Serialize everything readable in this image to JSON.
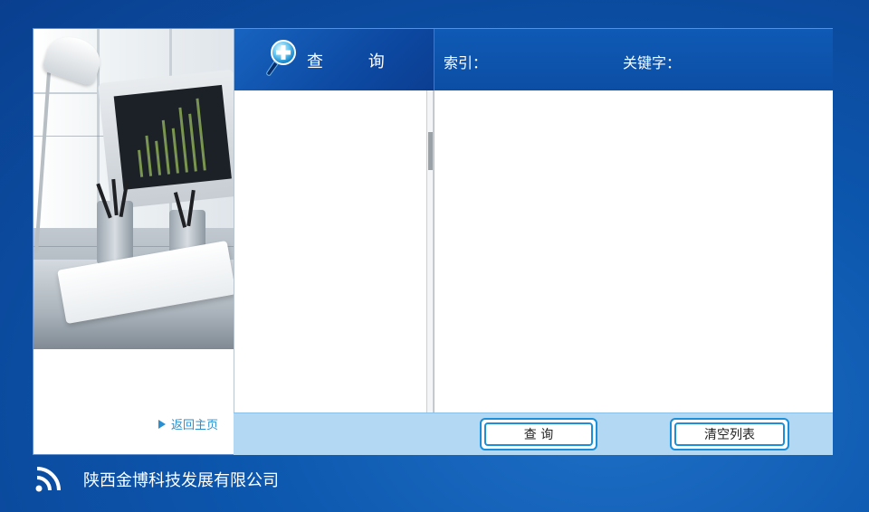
{
  "query_panel": {
    "title": "查 询"
  },
  "filters": {
    "index_label": "索引：",
    "keyword_label": "关键字："
  },
  "sidebar": {
    "home_link": "返回主页"
  },
  "actions": {
    "query_button": "查 询",
    "clear_button": "清空列表"
  },
  "footer": {
    "company_name": "陕西金博科技发展有限公司"
  },
  "colors": {
    "background": "#0c56ad",
    "header": "#0d4aa3",
    "action_bar": "#b2d8f4",
    "button_border": "#1b8fd9",
    "link": "#2a8fd1"
  },
  "icons": {
    "query": "magnifier-plus-icon",
    "home_arrow": "triangle-right-icon",
    "signal": "wifi-signal-icon"
  }
}
